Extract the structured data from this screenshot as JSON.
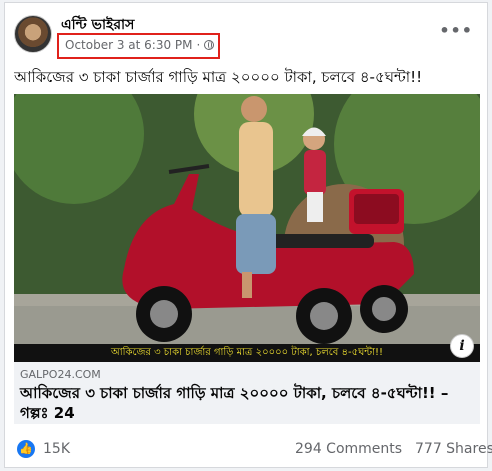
{
  "post": {
    "page_name": "এন্টি ভাইরাস",
    "timestamp": "October 3 at 6:30 PM",
    "separator": "·",
    "text": "আকিজের ৩ চাকা চার্জার গাড়ি মাত্র ২০০০০ টাকা, চলবে ৪-৫ঘন্টা!!",
    "image_banner": "আকিজের ৩ চাকা চার্জার গাড়ি মাত্র ২০০০০ টাকা, চলবে ৪-৫ঘন্টা!!",
    "link": {
      "domain": "GALPO24.COM",
      "title": "আকিজের ৩ চাকা চার্জার গাড়ি মাত্র ২০০০০ টাকা, চলবে ৪-৫ঘন্টা!! – গল্পঃ 24"
    },
    "reactions": "15K",
    "comments": "294 Comments",
    "shares": "777 Shares"
  },
  "icons": {
    "privacy": "globe-icon",
    "menu": "more-options-icon",
    "info": "info-icon",
    "like": "thumbs-up-icon"
  },
  "colors": {
    "highlight_box": "#e0211b",
    "like_blue": "#1877f2",
    "banner_text": "#f0e030"
  }
}
